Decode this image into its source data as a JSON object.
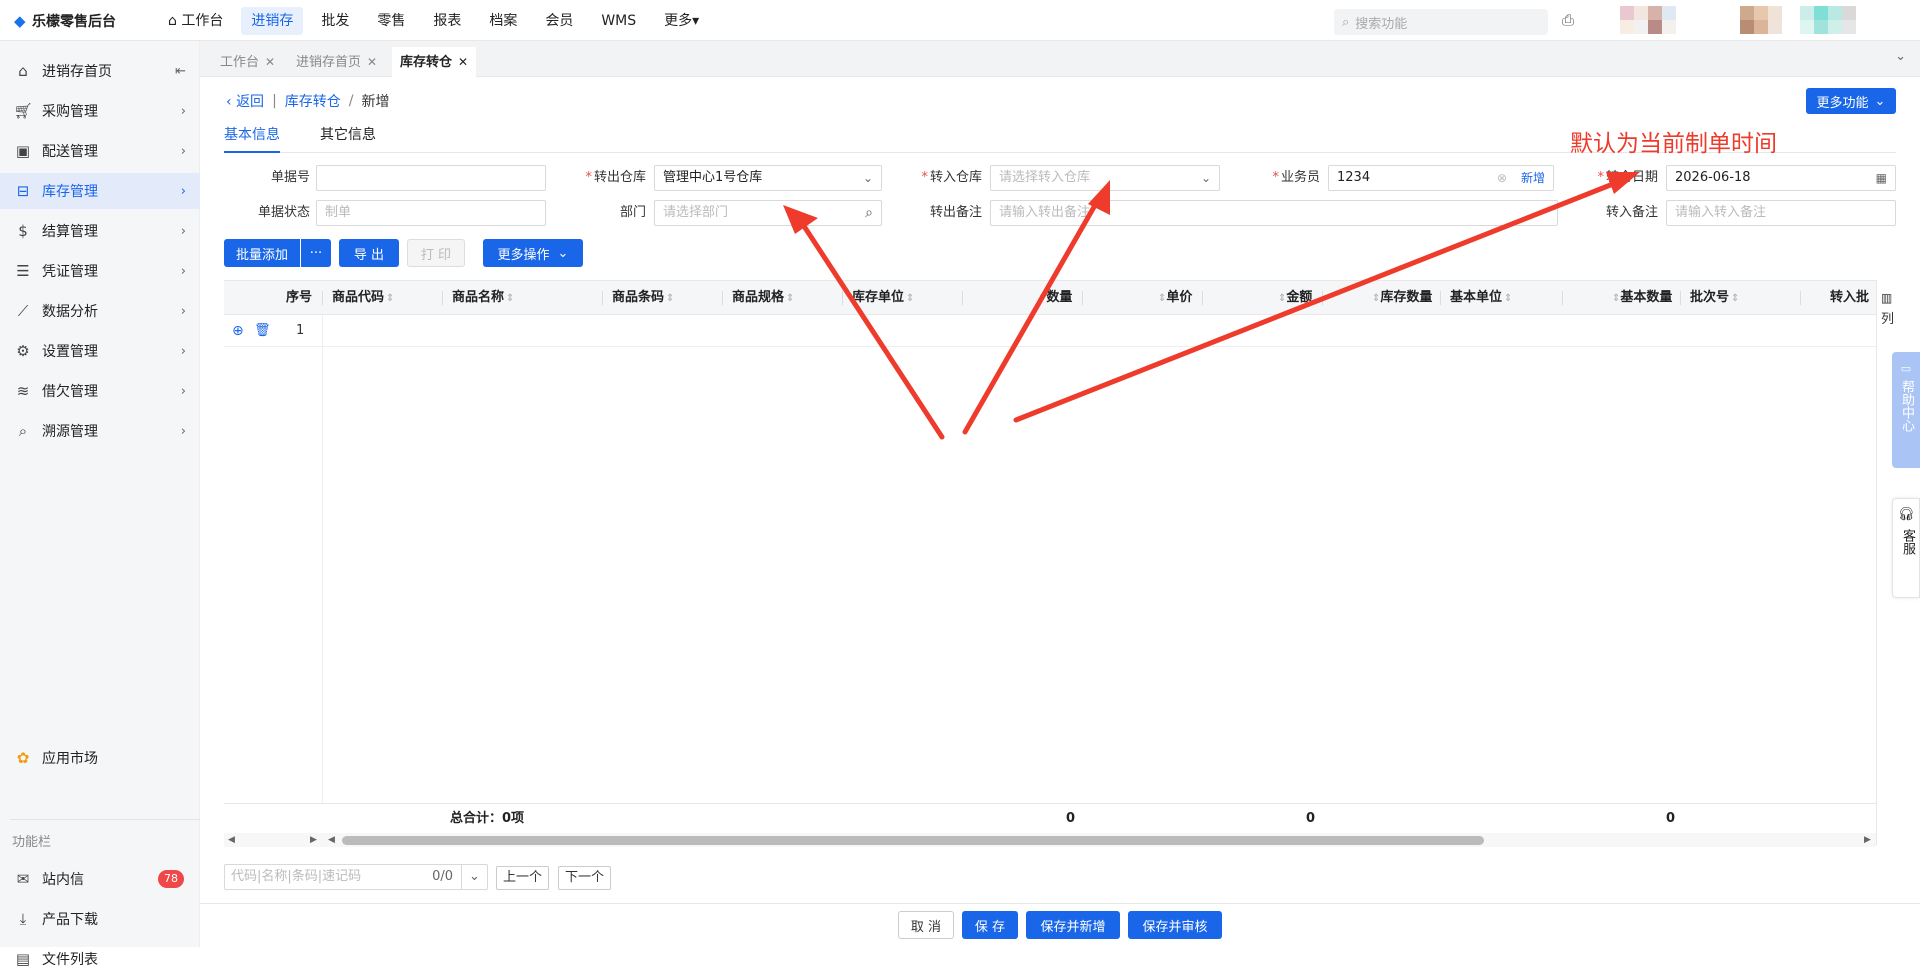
{
  "app": {
    "title": "乐檬零售后台"
  },
  "topnav": {
    "items": [
      "工作台",
      "进销存",
      "批发",
      "零售",
      "报表",
      "档案",
      "会员",
      "WMS",
      "更多"
    ],
    "active_index": 1
  },
  "search": {
    "placeholder": "搜索功能"
  },
  "sidebar": {
    "items": [
      "进销存首页",
      "采购管理",
      "配送管理",
      "库存管理",
      "结算管理",
      "凭证管理",
      "数据分析",
      "设置管理",
      "借欠管理",
      "溯源管理"
    ],
    "active_index": 3,
    "app_market": "应用市场",
    "section_label": "功能栏",
    "messages": "站内信",
    "messages_badge": "78",
    "downloads": "产品下载",
    "files": "文件列表"
  },
  "tabs": [
    "工作台",
    "进销存首页",
    "库存转仓"
  ],
  "breadcrumb": {
    "back": "返回",
    "parent": "库存转仓",
    "current": "新增"
  },
  "more_functions": "更多功能",
  "subtabs": [
    "基本信息",
    "其它信息"
  ],
  "form": {
    "doc_no": {
      "label": "单据号",
      "value": ""
    },
    "out_wh": {
      "label": "转出仓库",
      "value": "管理中心1号仓库"
    },
    "in_wh": {
      "label": "转入仓库",
      "placeholder": "请选择转入仓库"
    },
    "salesman": {
      "label": "业务员",
      "value": "1234",
      "add": "新增"
    },
    "date": {
      "label": "转仓日期",
      "value": "2026-06-18"
    },
    "status": {
      "label": "单据状态",
      "placeholder": "制单"
    },
    "dept": {
      "label": "部门",
      "placeholder": "请选择部门"
    },
    "out_note": {
      "label": "转出备注",
      "placeholder": "请输入转出备注"
    },
    "in_note": {
      "label": "转入备注",
      "placeholder": "请输入转入备注"
    }
  },
  "toolbar": {
    "batch_add": "批量添加",
    "more_dots": "···",
    "export": "导 出",
    "print": "打 印",
    "more_ops": "更多操作"
  },
  "table": {
    "columns": [
      "序号",
      "商品代码",
      "商品名称",
      "商品条码",
      "商品规格",
      "库存单位",
      "数量",
      "单价",
      "金额",
      "库存数量",
      "基本单位",
      "基本数量",
      "批次号",
      "转入批"
    ],
    "rows": [
      {
        "index": "1"
      }
    ],
    "footer": {
      "label": "总合计：0项",
      "qty": "0",
      "amount": "0",
      "base_qty": "0"
    },
    "col_setting": "列"
  },
  "finder": {
    "placeholder": "代码|名称|条码|速记码",
    "count": "0/0",
    "prev": "上一个",
    "next": "下一个"
  },
  "right_float": {
    "help": "帮助中心",
    "service": "客服"
  },
  "actions": {
    "cancel": "取 消",
    "save": "保 存",
    "save_new": "保存并新增",
    "save_audit": "保存并审核"
  },
  "annotation": {
    "text": "默认为当前制单时间",
    "color": "#ee3b2b"
  },
  "colors": {
    "accent": "#1a66e8",
    "badge": "#f04848",
    "sidebar_active_bg": "#e3ebfb"
  }
}
